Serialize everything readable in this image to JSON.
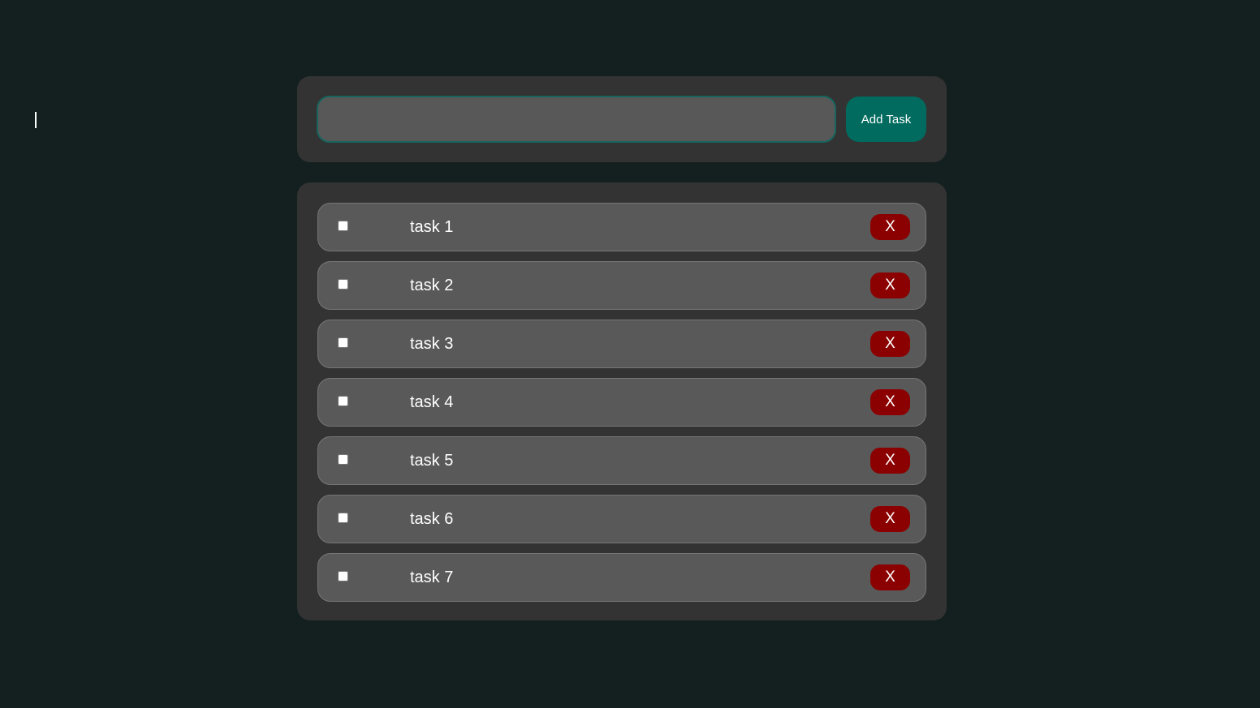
{
  "add_form": {
    "input_value": "",
    "input_placeholder": "",
    "add_label": "Add Task"
  },
  "tasks": [
    {
      "label": "task 1",
      "checked": false,
      "delete_label": "X"
    },
    {
      "label": "task 2",
      "checked": false,
      "delete_label": "X"
    },
    {
      "label": "task 3",
      "checked": false,
      "delete_label": "X"
    },
    {
      "label": "task 4",
      "checked": false,
      "delete_label": "X"
    },
    {
      "label": "task 5",
      "checked": false,
      "delete_label": "X"
    },
    {
      "label": "task 6",
      "checked": false,
      "delete_label": "X"
    },
    {
      "label": "task 7",
      "checked": false,
      "delete_label": "X"
    }
  ],
  "colors": {
    "background": "#142020",
    "panel": "#333333",
    "input": "#585858",
    "input_border": "#17665e",
    "accent": "#006b5e",
    "row": "#595959",
    "delete": "#8b0000"
  }
}
